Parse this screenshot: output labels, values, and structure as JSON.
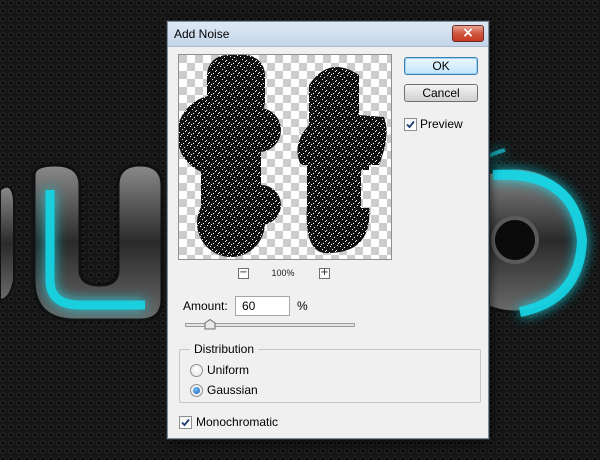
{
  "dialog": {
    "title": "Add Noise",
    "close_glyph": "×",
    "close_icon": "close-icon"
  },
  "preview_panel": {
    "zoom_level": "100%",
    "zoom_out_glyph": "−",
    "zoom_in_glyph": "+"
  },
  "buttons": {
    "ok_label": "OK",
    "cancel_label": "Cancel"
  },
  "preview_toggle": {
    "label": "Preview",
    "checked": true
  },
  "amount": {
    "label": "Amount:",
    "value": "60",
    "unit": "%",
    "slider_fraction": 0.15
  },
  "distribution": {
    "title": "Distribution",
    "options": [
      {
        "label": "Uniform",
        "selected": false
      },
      {
        "label": "Gaussian",
        "selected": true
      }
    ]
  },
  "monochromatic": {
    "label": "Monochromatic",
    "checked": true
  },
  "colors": {
    "glow_accent": "#18d6e6",
    "dialog_bg": "#f0f0f0",
    "close_button": "#c94a33",
    "ok_border": "#3c7fb1"
  }
}
